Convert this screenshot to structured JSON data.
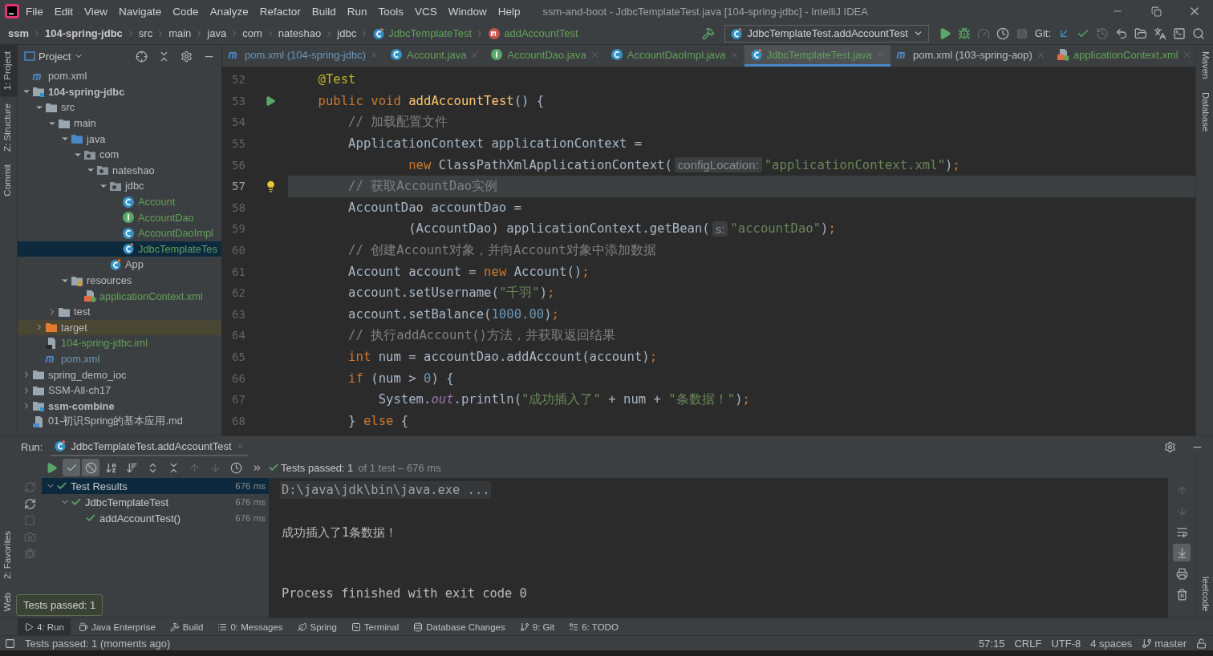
{
  "window": {
    "title": "ssm-and-boot - JdbcTemplateTest.java [104-spring-jdbc] - IntelliJ IDEA"
  },
  "menu": [
    "File",
    "Edit",
    "View",
    "Navigate",
    "Code",
    "Analyze",
    "Refactor",
    "Build",
    "Run",
    "Tools",
    "VCS",
    "Window",
    "Help"
  ],
  "breadcrumbs": [
    {
      "label": "ssm",
      "kind": "module"
    },
    {
      "label": "104-spring-jdbc",
      "kind": "module"
    },
    {
      "label": "src",
      "kind": "folder"
    },
    {
      "label": "main",
      "kind": "folder"
    },
    {
      "label": "java",
      "kind": "folder"
    },
    {
      "label": "com",
      "kind": "folder"
    },
    {
      "label": "nateshao",
      "kind": "folder"
    },
    {
      "label": "jdbc",
      "kind": "folder"
    },
    {
      "label": "JdbcTemplateTest",
      "kind": "class"
    },
    {
      "label": "addAccountTest",
      "kind": "method"
    }
  ],
  "run_config": "JdbcTemplateTest.addAccountTest",
  "git_label": "Git:",
  "left_tools_top": [
    {
      "label": "1: Project",
      "selected": true
    },
    {
      "label": "Z: Structure",
      "selected": false
    },
    {
      "label": "Commit",
      "selected": false
    }
  ],
  "left_tools_bottom": [
    {
      "label": "2: Favorites",
      "selected": false
    },
    {
      "label": "Web",
      "selected": false
    }
  ],
  "right_tools": [
    {
      "label": "Maven"
    },
    {
      "label": "Database"
    }
  ],
  "right_tools_bottom": [
    {
      "label": "leetcode"
    }
  ],
  "project": {
    "title": "Project",
    "tree": [
      {
        "label": "pom.xml",
        "kind": "maven",
        "color": "#bbbbbb",
        "selected": false
      },
      {
        "label": "104-spring-jdbc",
        "kind": "module",
        "color": "#bbbbbb",
        "selected": false,
        "expanded": true,
        "children": [
          {
            "label": "src",
            "kind": "folder",
            "color": "#bbbbbb",
            "selected": false,
            "expanded": true,
            "children": [
              {
                "label": "main",
                "kind": "folder",
                "color": "#bbbbbb",
                "selected": false,
                "expanded": true,
                "children": [
                  {
                    "label": "java",
                    "kind": "source-folder",
                    "color": "#bbbbbb",
                    "selected": false,
                    "expanded": true,
                    "children": [
                      {
                        "label": "com",
                        "kind": "package",
                        "color": "#bbbbbb",
                        "selected": false,
                        "expanded": true,
                        "children": [
                          {
                            "label": "nateshao",
                            "kind": "package",
                            "color": "#bbbbbb",
                            "selected": false,
                            "expanded": true,
                            "children": [
                              {
                                "label": "jdbc",
                                "kind": "package",
                                "color": "#bbbbbb",
                                "selected": false,
                                "expanded": true,
                                "children": [
                                  {
                                    "label": "Account",
                                    "kind": "class",
                                    "color": "#62a05a",
                                    "selected": false
                                  },
                                  {
                                    "label": "AccountDao",
                                    "kind": "interface",
                                    "color": "#62a05a",
                                    "selected": false
                                  },
                                  {
                                    "label": "AccountDaoImpl",
                                    "kind": "class",
                                    "color": "#62a05a",
                                    "selected": false
                                  },
                                  {
                                    "label": "JdbcTemplateTes",
                                    "kind": "test-class",
                                    "color": "#62a05a",
                                    "selected": true
                                  }
                                ]
                              },
                              {
                                "label": "App",
                                "kind": "test-class",
                                "color": "#bbbbbb",
                                "selected": false
                              }
                            ]
                          }
                        ]
                      }
                    ]
                  },
                  {
                    "label": "resources",
                    "kind": "resources-folder",
                    "color": "#bbbbbb",
                    "selected": false,
                    "expanded": true,
                    "children": [
                      {
                        "label": "applicationContext.xml",
                        "kind": "spring-xml",
                        "color": "#62a05a",
                        "selected": false
                      }
                    ]
                  }
                ]
              },
              {
                "label": "test",
                "kind": "folder",
                "color": "#bbbbbb",
                "selected": false,
                "expanded": false
              }
            ]
          },
          {
            "label": "target",
            "kind": "excluded-folder",
            "color": "#bbbbbb",
            "selected": false,
            "expanded": false
          },
          {
            "label": "104-spring-jdbc.iml",
            "kind": "iml",
            "color": "#62a05a",
            "selected": false
          },
          {
            "label": "pom.xml",
            "kind": "maven",
            "color": "#6897bb",
            "selected": false
          }
        ]
      },
      {
        "label": "spring_demo_ioc",
        "kind": "folder",
        "color": "#bbbbbb",
        "selected": false,
        "expanded": false
      },
      {
        "label": "SSM-All-ch17",
        "kind": "folder",
        "color": "#bbbbbb",
        "selected": false,
        "expanded": false
      },
      {
        "label": "ssm-combine",
        "kind": "module",
        "color": "#bbbbbb",
        "selected": false,
        "expanded": false
      },
      {
        "label": "01-初识Spring的基本应用.md",
        "kind": "markdown",
        "color": "#bbbbbb",
        "selected": false
      }
    ]
  },
  "tabs": [
    {
      "label": "pom.xml (104-spring-jdbc)",
      "kind": "maven",
      "color": "#6897bb",
      "selected": false
    },
    {
      "label": "Account.java",
      "kind": "class",
      "color": "#62a05a",
      "selected": false
    },
    {
      "label": "AccountDao.java",
      "kind": "interface",
      "color": "#62a05a",
      "selected": false
    },
    {
      "label": "AccountDaoImpl.java",
      "kind": "class",
      "color": "#62a05a",
      "selected": false
    },
    {
      "label": "JdbcTemplateTest.java",
      "kind": "test-class",
      "color": "#62a05a",
      "selected": true
    },
    {
      "label": "pom.xml (103-spring-aop)",
      "kind": "maven",
      "color": "#bbbbbb",
      "selected": false
    },
    {
      "label": "applicationContext.xml",
      "kind": "spring-xml",
      "color": "#62a05a",
      "selected": false
    }
  ],
  "editor": {
    "lines": [
      {
        "number": "52",
        "current": false,
        "tokens": [
          {
            "kind": "ann",
            "text": "    @Test"
          }
        ]
      },
      {
        "number": "53",
        "current": false,
        "gutter": {
          "kind": "run"
        },
        "tokens": [
          {
            "kind": "kw",
            "text": "    public void "
          },
          {
            "kind": "fn",
            "text": "addAccountTest"
          },
          {
            "kind": "pl",
            "text": "() {"
          }
        ]
      },
      {
        "number": "54",
        "current": false,
        "tokens": [
          {
            "kind": "com",
            "text": "        // 加载配置文件"
          }
        ]
      },
      {
        "number": "55",
        "current": false,
        "tokens": [
          {
            "kind": "pl",
            "text": "        ApplicationContext applicationContext ="
          }
        ]
      },
      {
        "number": "56",
        "current": false,
        "tokens": [
          {
            "kind": "kw",
            "text": "                new "
          },
          {
            "kind": "pl",
            "text": "ClassPathXmlApplicationContext("
          },
          {
            "kind": "hint",
            "text": "configLocation:"
          },
          {
            "kind": "str",
            "text": "\"applicationContext.xml\""
          },
          {
            "kind": "pl",
            "text": ")"
          },
          {
            "kind": "kw",
            "text": ";"
          }
        ]
      },
      {
        "number": "57",
        "current": true,
        "gutter": {
          "kind": "bulb"
        },
        "tokens": [
          {
            "kind": "com",
            "text": "        // 获取AccountDao实例"
          }
        ]
      },
      {
        "number": "58",
        "current": false,
        "tokens": [
          {
            "kind": "pl",
            "text": "        AccountDao accountDao ="
          }
        ]
      },
      {
        "number": "59",
        "current": false,
        "tokens": [
          {
            "kind": "pl",
            "text": "                (AccountDao) applicationContext.getBean("
          },
          {
            "kind": "hint",
            "text": "s:"
          },
          {
            "kind": "str",
            "text": "\"accountDao\""
          },
          {
            "kind": "pl",
            "text": ")"
          },
          {
            "kind": "kw",
            "text": ";"
          }
        ]
      },
      {
        "number": "60",
        "current": false,
        "tokens": [
          {
            "kind": "com",
            "text": "        // 创建Account对象，并向Account对象中添加数据"
          }
        ]
      },
      {
        "number": "61",
        "current": false,
        "tokens": [
          {
            "kind": "pl",
            "text": "        Account account = "
          },
          {
            "kind": "kw",
            "text": "new "
          },
          {
            "kind": "pl",
            "text": "Account()"
          },
          {
            "kind": "kw",
            "text": ";"
          }
        ]
      },
      {
        "number": "62",
        "current": false,
        "tokens": [
          {
            "kind": "pl",
            "text": "        account.setUsername("
          },
          {
            "kind": "str",
            "text": "\"千羽\""
          },
          {
            "kind": "pl",
            "text": ")"
          },
          {
            "kind": "kw",
            "text": ";"
          }
        ]
      },
      {
        "number": "63",
        "current": false,
        "tokens": [
          {
            "kind": "pl",
            "text": "        account.setBalance("
          },
          {
            "kind": "num",
            "text": "1000.00"
          },
          {
            "kind": "pl",
            "text": ")"
          },
          {
            "kind": "kw",
            "text": ";"
          }
        ]
      },
      {
        "number": "64",
        "current": false,
        "tokens": [
          {
            "kind": "com",
            "text": "        // 执行addAccount()方法，并获取返回结果"
          }
        ]
      },
      {
        "number": "65",
        "current": false,
        "tokens": [
          {
            "kind": "kw",
            "text": "        int "
          },
          {
            "kind": "pl",
            "text": "num = accountDao.addAccount(account)"
          },
          {
            "kind": "kw",
            "text": ";"
          }
        ]
      },
      {
        "number": "66",
        "current": false,
        "tokens": [
          {
            "kind": "kw",
            "text": "        if "
          },
          {
            "kind": "pl",
            "text": "(num > "
          },
          {
            "kind": "num",
            "text": "0"
          },
          {
            "kind": "pl",
            "text": ") {"
          }
        ]
      },
      {
        "number": "67",
        "current": false,
        "tokens": [
          {
            "kind": "pl",
            "text": "            System."
          },
          {
            "kind": "static",
            "text": "out"
          },
          {
            "kind": "pl",
            "text": ".println("
          },
          {
            "kind": "str",
            "text": "\"成功插入了\""
          },
          {
            "kind": "pl",
            "text": " + num + "
          },
          {
            "kind": "str",
            "text": "\"条数据！\""
          },
          {
            "kind": "pl",
            "text": ")"
          },
          {
            "kind": "kw",
            "text": ";"
          }
        ]
      },
      {
        "number": "68",
        "current": false,
        "tokens": [
          {
            "kind": "pl",
            "text": "        } "
          },
          {
            "kind": "kw",
            "text": "else "
          },
          {
            "kind": "pl",
            "text": "{"
          }
        ]
      }
    ]
  },
  "run": {
    "label": "Run:",
    "tab": "JdbcTemplateTest.addAccountTest",
    "filters": [
      {
        "kind": "passed",
        "selected": true
      },
      {
        "kind": "ignored",
        "selected": true
      }
    ],
    "status": {
      "text": "Tests passed: 1",
      "detail": "of 1 test – 676 ms"
    },
    "tree": [
      {
        "label": "Test Results",
        "time": "676 ms",
        "selected": true,
        "expanded": true,
        "children": [
          {
            "label": "JdbcTemplateTest",
            "time": "676 ms",
            "selected": false,
            "expanded": true,
            "children": [
              {
                "label": "addAccountTest()",
                "time": "676 ms",
                "selected": false
              }
            ]
          }
        ]
      }
    ],
    "console": [
      {
        "kind": "command",
        "text": "D:\\java\\jdk\\bin\\java.exe ..."
      },
      {
        "kind": "output",
        "text": "成功插入了1条数据！"
      },
      {
        "kind": "exit",
        "text": "Process finished with exit code 0"
      }
    ],
    "autoscroll": true,
    "tooltip": "Tests passed: 1"
  },
  "tool_windows": [
    {
      "label": "4: Run",
      "kind": "run",
      "selected": true
    },
    {
      "label": "Java Enterprise",
      "kind": "enterprise",
      "selected": false
    },
    {
      "label": "Build",
      "kind": "build",
      "selected": false
    },
    {
      "label": "0: Messages",
      "kind": "messages",
      "selected": false
    },
    {
      "label": "Spring",
      "kind": "spring",
      "selected": false
    },
    {
      "label": "Terminal",
      "kind": "terminal",
      "selected": false
    },
    {
      "label": "Database Changes",
      "kind": "database",
      "selected": false
    },
    {
      "label": "9: Git",
      "kind": "git",
      "selected": false
    },
    {
      "label": "6: TODO",
      "kind": "todo",
      "selected": false
    }
  ],
  "status_bar": {
    "message": "Tests passed: 1 (moments ago)",
    "items": [
      "57:15",
      "CRLF",
      "UTF-8",
      "4 spaces"
    ],
    "branch": "master"
  }
}
